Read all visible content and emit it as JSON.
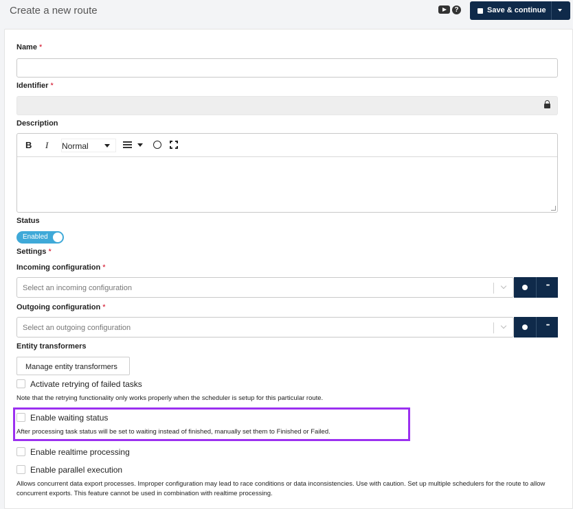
{
  "header": {
    "title": "Create a new route",
    "youtube_icon": "youtube-icon",
    "help_label": "?",
    "save_button": "Save & continue"
  },
  "form": {
    "name": {
      "label": "Name",
      "required_mark": "*",
      "value": ""
    },
    "identifier": {
      "label": "Identifier",
      "required_mark": "*",
      "value": ""
    },
    "description": {
      "label": "Description",
      "toolbar": {
        "bold": "B",
        "italic": "I",
        "format": "Normal"
      }
    },
    "status": {
      "label": "Status",
      "toggle": "Enabled"
    },
    "settings": {
      "label": "Settings",
      "required_mark": "*"
    },
    "incoming": {
      "label": "Incoming configuration",
      "required_mark": "*",
      "placeholder": "Select an incoming configuration"
    },
    "outgoing": {
      "label": "Outgoing configuration",
      "required_mark": "*",
      "placeholder": "Select an outgoing configuration"
    },
    "transformers": {
      "label": "Entity transformers",
      "button": "Manage entity transformers"
    },
    "retry": {
      "label": "Activate retrying of failed tasks",
      "note": "Note that the retrying functionality only works properly when the scheduler is setup for this particular route."
    },
    "waiting": {
      "label": "Enable waiting status",
      "note": "After processing task status will be set to waiting instead of finished, manually set them to Finished or Failed."
    },
    "realtime": {
      "label": "Enable realtime processing"
    },
    "parallel": {
      "label": "Enable parallel execution",
      "note": "Allows concurrent data export processes. Improper configuration may lead to race conditions or data inconsistencies. Use with caution. Set up multiple schedulers for the route to allow concurrent exports. This feature cannot be used in combination with realtime processing."
    }
  },
  "colors": {
    "primary": "#0f2a4a",
    "toggle": "#3fa9d8",
    "highlight": "#9b30f0",
    "required": "#d0021b"
  }
}
